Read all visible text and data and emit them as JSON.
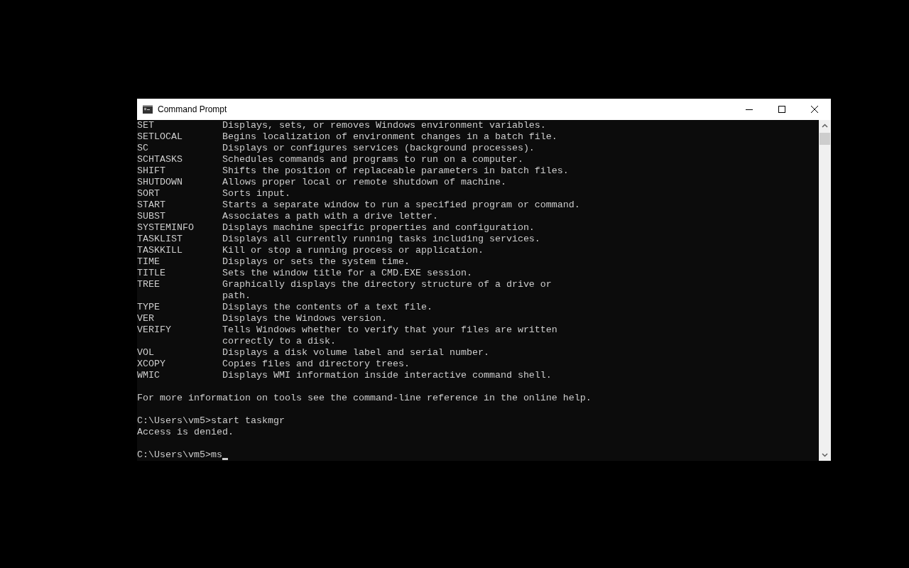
{
  "window": {
    "title": "Command Prompt"
  },
  "console": {
    "lines": [
      {
        "kind": "text",
        "text": "SET            Displays, sets, or removes Windows environment variables."
      },
      {
        "kind": "text",
        "text": "SETLOCAL       Begins localization of environment changes in a batch file."
      },
      {
        "kind": "text",
        "text": "SC             Displays or configures services (background processes)."
      },
      {
        "kind": "text",
        "text": "SCHTASKS       Schedules commands and programs to run on a computer."
      },
      {
        "kind": "text",
        "text": "SHIFT          Shifts the position of replaceable parameters in batch files."
      },
      {
        "kind": "text",
        "text": "SHUTDOWN       Allows proper local or remote shutdown of machine."
      },
      {
        "kind": "text",
        "text": "SORT           Sorts input."
      },
      {
        "kind": "text",
        "text": "START          Starts a separate window to run a specified program or command."
      },
      {
        "kind": "text",
        "text": "SUBST          Associates a path with a drive letter."
      },
      {
        "kind": "text",
        "text": "SYSTEMINFO     Displays machine specific properties and configuration."
      },
      {
        "kind": "text",
        "text": "TASKLIST       Displays all currently running tasks including services."
      },
      {
        "kind": "text",
        "text": "TASKKILL       Kill or stop a running process or application."
      },
      {
        "kind": "text",
        "text": "TIME           Displays or sets the system time."
      },
      {
        "kind": "text",
        "text": "TITLE          Sets the window title for a CMD.EXE session."
      },
      {
        "kind": "text",
        "text": "TREE           Graphically displays the directory structure of a drive or"
      },
      {
        "kind": "text",
        "text": "               path."
      },
      {
        "kind": "text",
        "text": "TYPE           Displays the contents of a text file."
      },
      {
        "kind": "text",
        "text": "VER            Displays the Windows version."
      },
      {
        "kind": "text",
        "text": "VERIFY         Tells Windows whether to verify that your files are written"
      },
      {
        "kind": "text",
        "text": "               correctly to a disk."
      },
      {
        "kind": "text",
        "text": "VOL            Displays a disk volume label and serial number."
      },
      {
        "kind": "text",
        "text": "XCOPY          Copies files and directory trees."
      },
      {
        "kind": "text",
        "text": "WMIC           Displays WMI information inside interactive command shell."
      },
      {
        "kind": "blank"
      },
      {
        "kind": "text",
        "text": "For more information on tools see the command-line reference in the online help."
      },
      {
        "kind": "blank"
      },
      {
        "kind": "text",
        "text": "C:\\Users\\vm5>start taskmgr"
      },
      {
        "kind": "text",
        "text": "Access is denied."
      },
      {
        "kind": "blank"
      },
      {
        "kind": "text",
        "text": "C:\\Users\\vm5>ms",
        "cursor": true
      }
    ]
  }
}
